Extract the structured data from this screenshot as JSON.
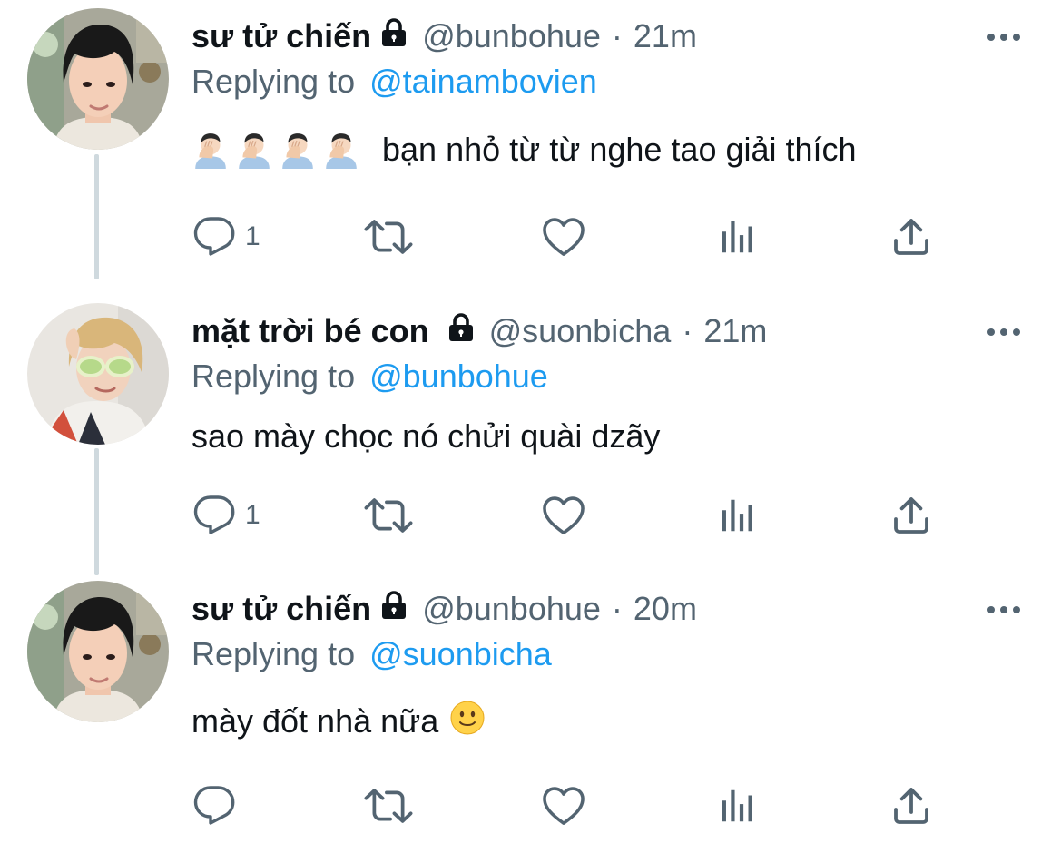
{
  "colors": {
    "text": "#0f1419",
    "secondary": "#536471",
    "mention": "#1d9bf0",
    "thread_line": "#cfd9de"
  },
  "tweets": [
    {
      "name": "sư tử chiến",
      "handle": "@bunbohue",
      "separator": "·",
      "time": "21m",
      "locked": true,
      "replying_label": "Replying to",
      "replying_to": "@tainambovien",
      "text": "bạn nhỏ từ từ nghe tao giải thích",
      "leading_emoji": [
        "man-facepalming",
        "man-facepalming",
        "man-facepalming",
        "man-facepalming"
      ],
      "reply_count": "1"
    },
    {
      "name": "mặt trời bé con",
      "handle": "@suonbicha",
      "separator": "·",
      "time": "21m",
      "locked": true,
      "replying_label": "Replying to",
      "replying_to": "@bunbohue",
      "text": "sao mày chọc nó chửi quài dzãy",
      "reply_count": "1"
    },
    {
      "name": "sư tử chiến",
      "handle": "@bunbohue",
      "separator": "·",
      "time": "20m",
      "locked": true,
      "replying_label": "Replying to",
      "replying_to": "@suonbicha",
      "text": "mày đốt nhà nữa",
      "trailing_emoji": "slightly-smiling-face",
      "reply_count": ""
    }
  ],
  "action_icons": [
    "reply-icon",
    "retweet-icon",
    "like-icon",
    "analytics-icon",
    "share-icon"
  ]
}
